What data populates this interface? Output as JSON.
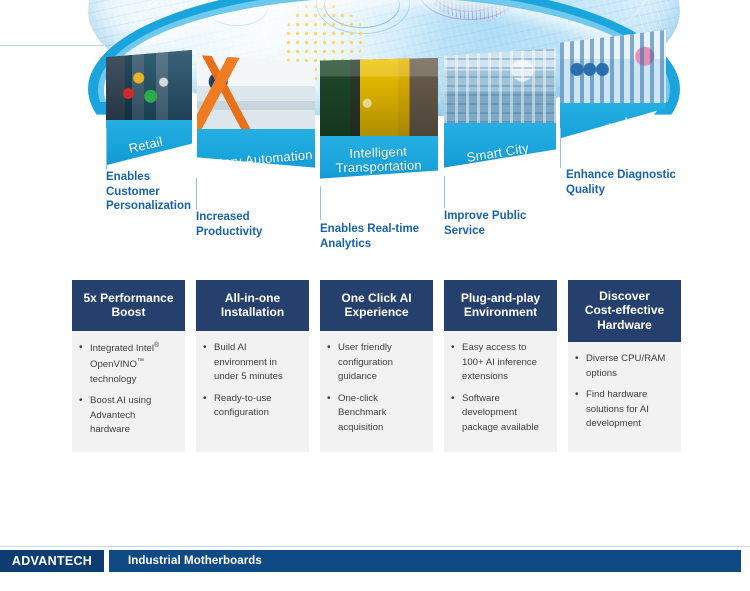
{
  "hero": {
    "segments": [
      {
        "label": "Retail",
        "photo": "retail-photo",
        "callout": "Enables\nCustomer\nPersonalization"
      },
      {
        "label": "Factory\nAutomation",
        "photo": "factory-photo",
        "callout": "Increased\nProductivity"
      },
      {
        "label": "Intelligent\nTransportation",
        "photo": "transport-photo",
        "callout": "Enables Real-time\nAnalytics"
      },
      {
        "label": "Smart City",
        "photo": "smart-city-photo",
        "callout": "Improve Public\nService"
      },
      {
        "label": "Medical",
        "photo": "medical-photo",
        "callout": "Enhance Diagnostic\nQuality"
      }
    ]
  },
  "cards": [
    {
      "title": "5x Performance\nBoost",
      "bullets_html": [
        "Integrated Intel<span class=\"sup\">®</span> OpenVINO<span class=\"sup\">™</span> technology",
        "Boost AI using Advantech hardware"
      ]
    },
    {
      "title": "All-in-one\nInstallation",
      "bullets_html": [
        "Build AI environment in under 5 minutes",
        "Ready-to-use configuration"
      ]
    },
    {
      "title": "One Click AI\nExperience",
      "bullets_html": [
        "User friendly configuration guidance",
        "One-click Benchmark acquisition"
      ]
    },
    {
      "title": "Plug-and-play\nEnvironment",
      "bullets_html": [
        "Easy access to 100+ AI inference extensions",
        "Software development package available"
      ]
    },
    {
      "title": "Discover\nCost-effective\nHardware",
      "bullets_html": [
        "Diverse CPU/RAM options",
        "Find hardware solutions for AI development"
      ]
    }
  ],
  "footer": {
    "logo": "ADVANTECH",
    "title": "Industrial Motherboards"
  },
  "colors": {
    "navy_card_header": "#26406e",
    "card_body_bg": "#f2f2f2",
    "ribbon_blue": "#17a2da",
    "callout_blue": "#1763ab",
    "footer_logo_navy": "#0d3d70",
    "footer_bar_blue": "#0f4a85"
  }
}
